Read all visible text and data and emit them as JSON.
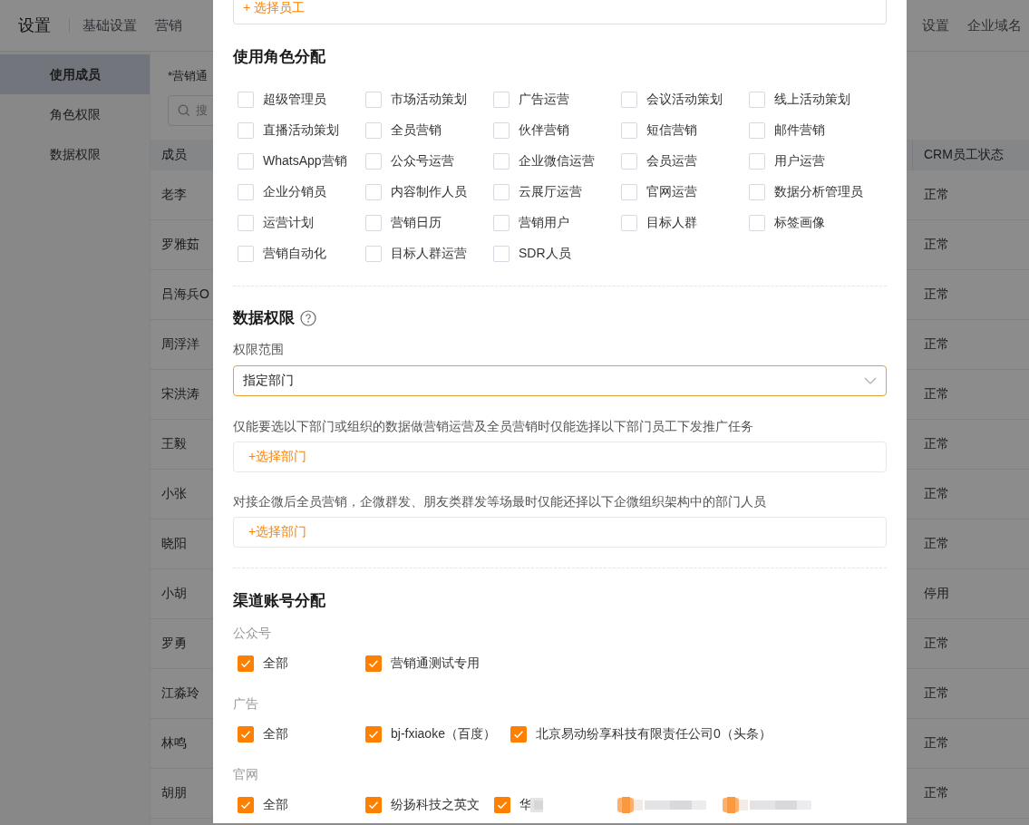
{
  "header": {
    "title": "设置",
    "tabs_left": [
      {
        "label": "基础设置"
      },
      {
        "label": "营销"
      }
    ],
    "tabs_right": [
      {
        "label": "设置"
      },
      {
        "label": "企业域名"
      }
    ]
  },
  "sidebar": {
    "items": [
      {
        "label": "使用成员",
        "selected": true
      },
      {
        "label": "角色权限",
        "selected": false
      },
      {
        "label": "数据权限",
        "selected": false
      }
    ]
  },
  "filter": {
    "label": "*营销通",
    "search_placeholder": "搜"
  },
  "table": {
    "columns": [
      "成员",
      "CRM员工状态"
    ],
    "rows": [
      [
        "老李",
        "正常"
      ],
      [
        "罗雅茹",
        "正常"
      ],
      [
        "吕海兵O",
        "正常"
      ],
      [
        "周浮洋",
        "正常"
      ],
      [
        "宋洪涛",
        "正常"
      ],
      [
        "王毅",
        "正常"
      ],
      [
        "小张",
        "正常"
      ],
      [
        "晓阳",
        "正常"
      ],
      [
        "小胡",
        "停用"
      ],
      [
        "罗勇",
        "正常"
      ],
      [
        "江淼玲",
        "正常"
      ],
      [
        "林鸣",
        "正常"
      ],
      [
        "胡朋",
        "正常"
      ]
    ]
  },
  "modal": {
    "employee_picker": "+ 选择员工",
    "roles": {
      "title": "使用角色分配",
      "items": [
        {
          "label": "超级管理员",
          "checked": false
        },
        {
          "label": "市场活动策划",
          "checked": false
        },
        {
          "label": "广告运营",
          "checked": false
        },
        {
          "label": "会议活动策划",
          "checked": false
        },
        {
          "label": "线上活动策划",
          "checked": false
        },
        {
          "label": "直播活动策划",
          "checked": false
        },
        {
          "label": "全员营销",
          "checked": false
        },
        {
          "label": "伙伴营销",
          "checked": false
        },
        {
          "label": "短信营销",
          "checked": false
        },
        {
          "label": "邮件营销",
          "checked": false
        },
        {
          "label": "WhatsApp营销",
          "checked": false
        },
        {
          "label": "公众号运营",
          "checked": false
        },
        {
          "label": "企业微信运营",
          "checked": false
        },
        {
          "label": "会员运营",
          "checked": false
        },
        {
          "label": "用户运营",
          "checked": false
        },
        {
          "label": "企业分销员",
          "checked": false
        },
        {
          "label": "内容制作人员",
          "checked": false
        },
        {
          "label": "云展厅运营",
          "checked": false
        },
        {
          "label": "官网运营",
          "checked": false
        },
        {
          "label": "数据分析管理员",
          "checked": false
        },
        {
          "label": "运营计划",
          "checked": false
        },
        {
          "label": "营销日历",
          "checked": false
        },
        {
          "label": "营销用户",
          "checked": false
        },
        {
          "label": "目标人群",
          "checked": false
        },
        {
          "label": "标签画像",
          "checked": false
        },
        {
          "label": "营销自动化",
          "checked": false
        },
        {
          "label": "目标人群运营",
          "checked": false
        },
        {
          "label": "SDR人员",
          "checked": false
        }
      ]
    },
    "data_permission": {
      "title": "数据权限",
      "scope_label": "权限范围",
      "scope_value": "指定部门",
      "fields": [
        {
          "description": "仅能要选以下部门或组织的数据做营销运营及全员营销时仅能选择以下部门员工下发推广任务",
          "action": "+选择部门"
        },
        {
          "description": "对接企微后全员营销，企微群发、朋友类群发等场最时仅能还择以下企微组织架构中的部门人员",
          "action": "+选择部门"
        }
      ]
    },
    "channels": {
      "title": "渠道账号分配",
      "groups": [
        {
          "name": "公众号",
          "items": [
            {
              "kind": "checkbox",
              "label": "全部",
              "checked": true
            },
            {
              "kind": "checkbox",
              "label": "营销通测试专用",
              "checked": true
            }
          ]
        },
        {
          "name": "广告",
          "items": [
            {
              "kind": "checkbox",
              "label": "全部",
              "checked": true
            },
            {
              "kind": "checkbox",
              "label": "bj-fxiaoke（百度）",
              "checked": true
            },
            {
              "kind": "checkbox",
              "label": "北京易动纷享科技有限责任公司0（头条）",
              "checked": true
            }
          ]
        },
        {
          "name": "官网",
          "items": [
            {
              "kind": "checkbox",
              "label": "全部",
              "checked": true
            },
            {
              "kind": "checkbox",
              "label": "纷扬科技之英文",
              "checked": true
            },
            {
              "kind": "partial",
              "label": "华",
              "checked": true
            },
            {
              "kind": "redacted"
            },
            {
              "kind": "redacted"
            }
          ]
        }
      ]
    }
  }
}
